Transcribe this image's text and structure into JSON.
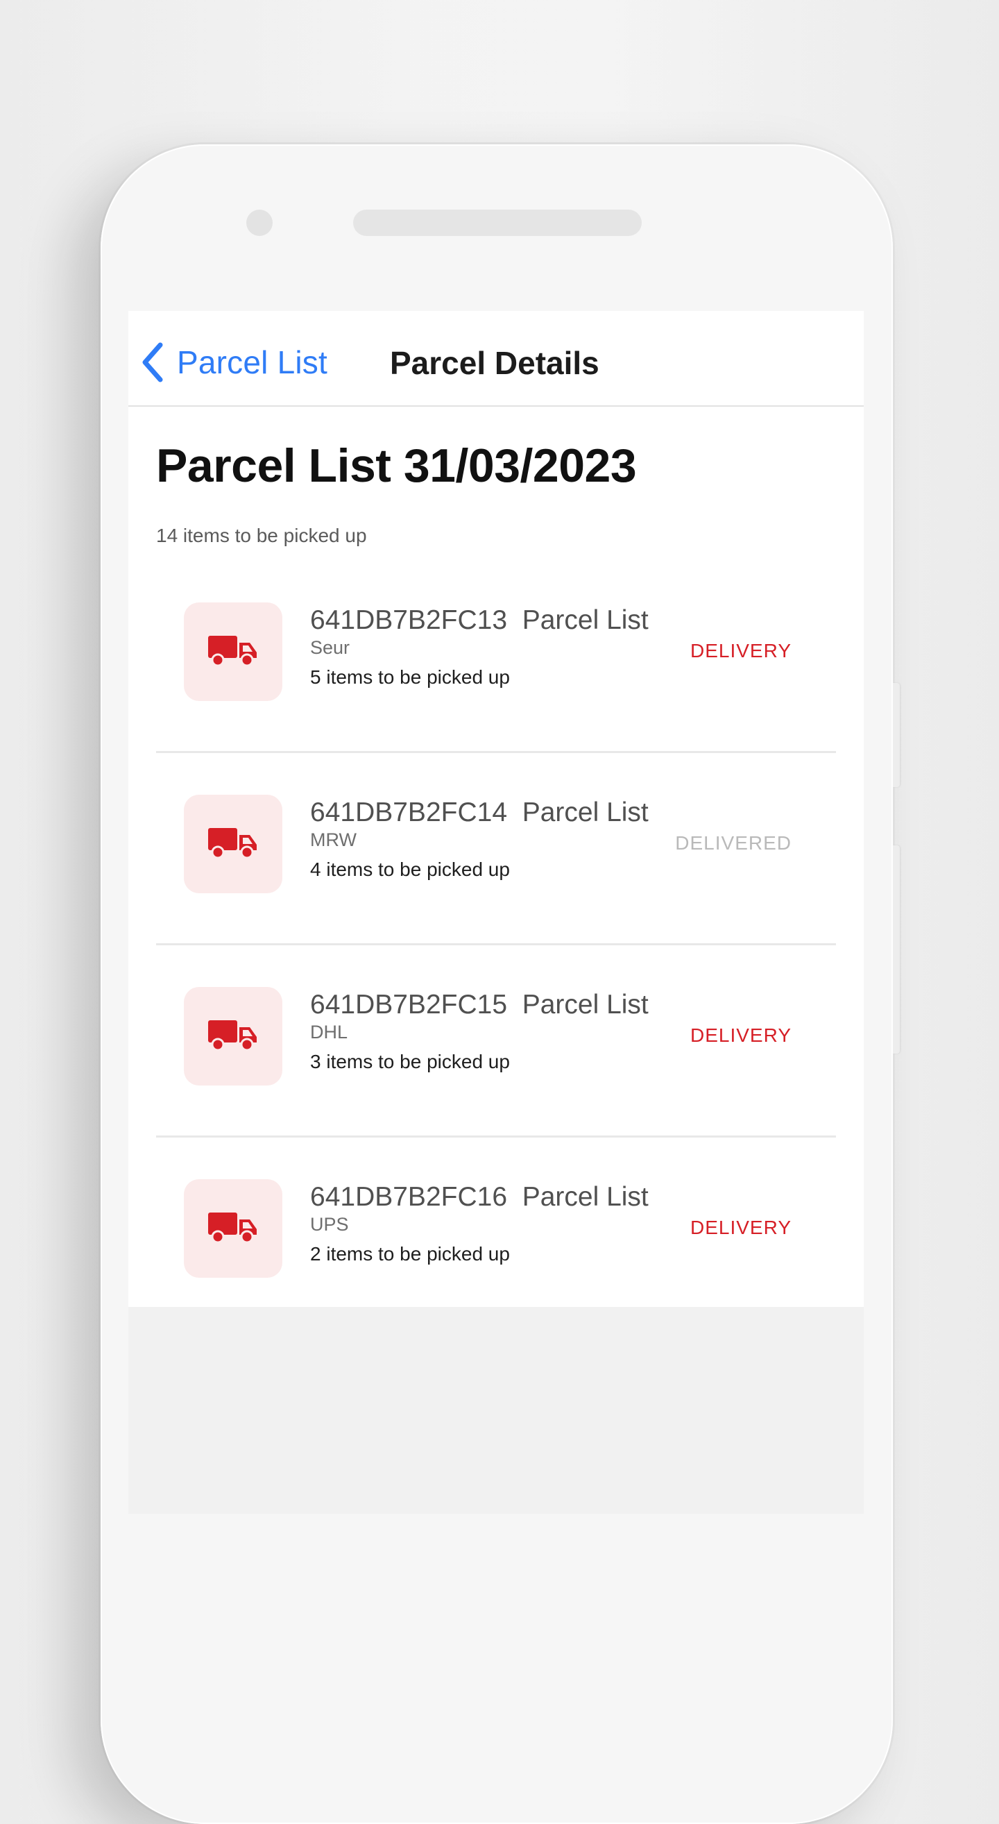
{
  "nav": {
    "back_label": "Parcel List",
    "title": "Parcel Details"
  },
  "header": {
    "title": "Parcel List 31/03/2023",
    "subtitle": "14 items to be picked up"
  },
  "parcels": [
    {
      "id": "641DB7B2FC13",
      "label": "Parcel List",
      "carrier": "Seur",
      "count": "5 items to be picked up",
      "status": "DELIVERY",
      "icon": "truck-icon"
    },
    {
      "id": "641DB7B2FC14",
      "label": "Parcel List",
      "carrier": "MRW",
      "count": "4 items to be picked up",
      "status": "DELIVERED",
      "icon": "truck-icon"
    },
    {
      "id": "641DB7B2FC15",
      "label": "Parcel List",
      "carrier": "DHL",
      "count": "3 items to be picked up",
      "status": "DELIVERY",
      "icon": "truck-icon"
    },
    {
      "id": "641DB7B2FC16",
      "label": "Parcel List",
      "carrier": "UPS",
      "count": "2 items to be picked up",
      "status": "DELIVERY",
      "icon": "truck-icon"
    }
  ],
  "colors": {
    "accent": "#2f7cf6",
    "delivery": "#d61f26",
    "delivered": "#b9b9b9",
    "icon_tile": "#fbeaea"
  }
}
